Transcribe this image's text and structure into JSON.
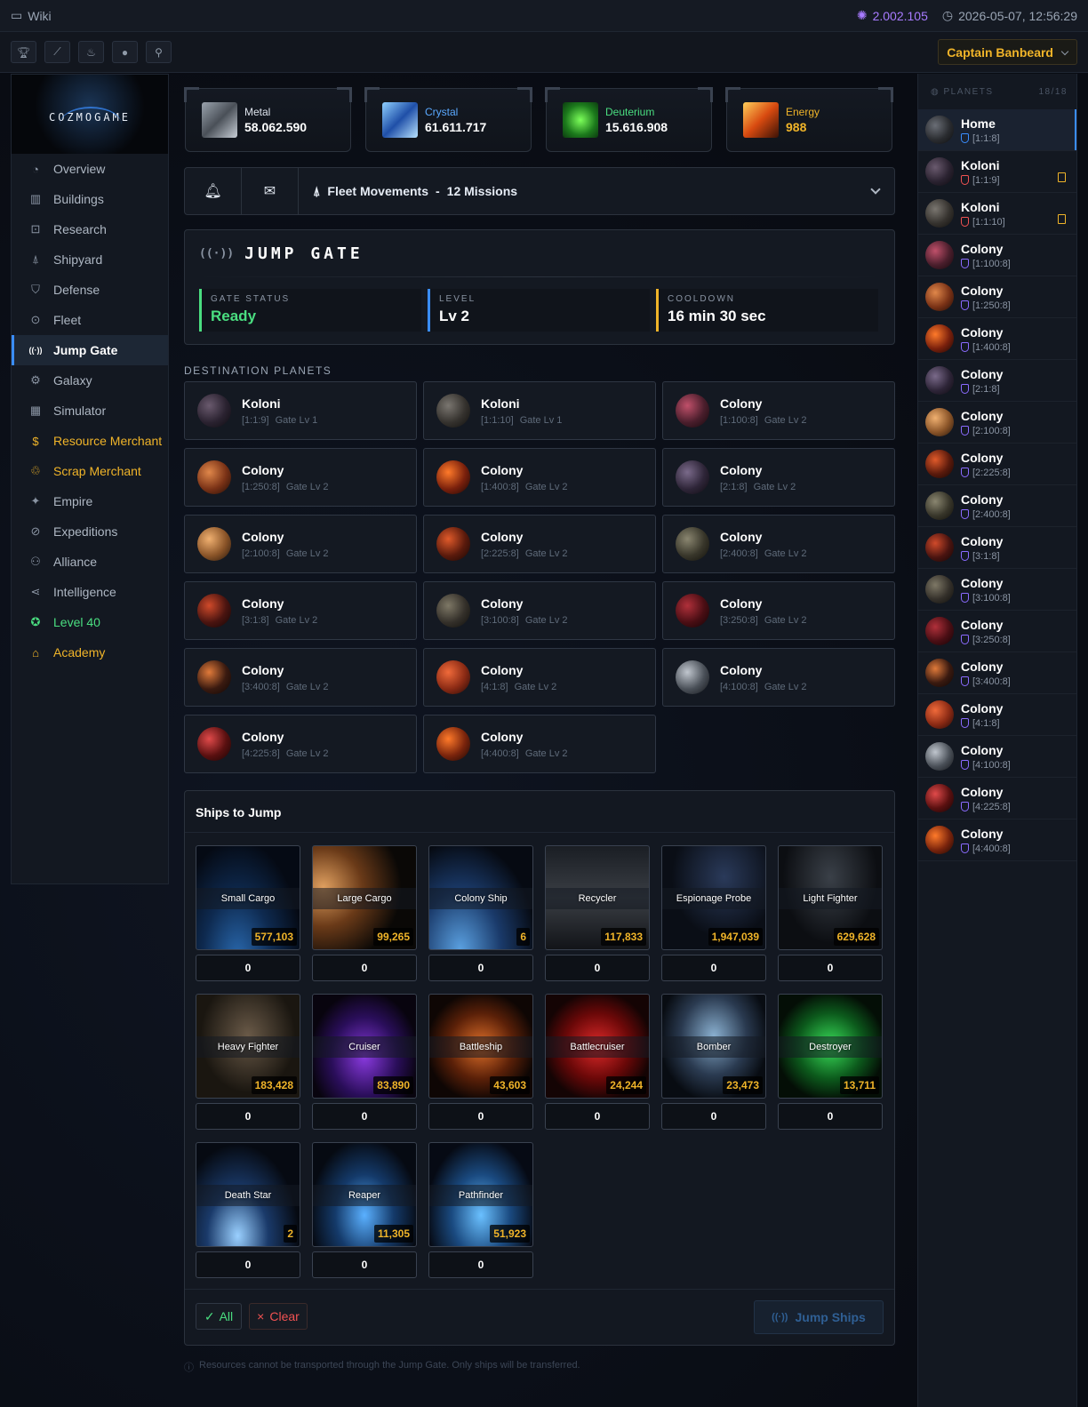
{
  "topbar": {
    "wiki": "Wiki",
    "dark_matter": "2.002.105",
    "datetime": "2026-05-07, 12:56:29"
  },
  "toolbar": {
    "captain": "Captain Banbeard"
  },
  "logo": "COZMOGAME",
  "nav": [
    {
      "label": "Overview",
      "icon": "gauge-icon",
      "glyph": "◔",
      "style": ""
    },
    {
      "label": "Buildings",
      "icon": "buildings-icon",
      "glyph": "▥",
      "style": ""
    },
    {
      "label": "Research",
      "icon": "chip-icon",
      "glyph": "⊡",
      "style": ""
    },
    {
      "label": "Shipyard",
      "icon": "rocket-icon",
      "glyph": "⍋",
      "style": ""
    },
    {
      "label": "Defense",
      "icon": "shield-icon",
      "glyph": "⛉",
      "style": ""
    },
    {
      "label": "Fleet",
      "icon": "target-icon",
      "glyph": "⊙",
      "style": ""
    },
    {
      "label": "Jump Gate",
      "icon": "signal-icon",
      "glyph": "((·))",
      "style": "active"
    },
    {
      "label": "Galaxy",
      "icon": "galaxy-icon",
      "glyph": "⚙",
      "style": ""
    },
    {
      "label": "Simulator",
      "icon": "calculator-icon",
      "glyph": "▦",
      "style": ""
    },
    {
      "label": "Resource Merchant",
      "icon": "coin-icon",
      "glyph": "$",
      "style": "gold"
    },
    {
      "label": "Scrap Merchant",
      "icon": "recycle-icon",
      "glyph": "♲",
      "style": "gold"
    },
    {
      "label": "Empire",
      "icon": "sparkle-icon",
      "glyph": "✦",
      "style": ""
    },
    {
      "label": "Expeditions",
      "icon": "compass-icon",
      "glyph": "⊘",
      "style": ""
    },
    {
      "label": "Alliance",
      "icon": "users-icon",
      "glyph": "⚇",
      "style": ""
    },
    {
      "label": "Intelligence",
      "icon": "share-icon",
      "glyph": "⋖",
      "style": ""
    },
    {
      "label": "Level 40",
      "icon": "award-icon",
      "glyph": "✪",
      "style": "green"
    },
    {
      "label": "Academy",
      "icon": "graduation-icon",
      "glyph": "⌂",
      "style": "gold"
    }
  ],
  "resources": [
    {
      "name": "Metal",
      "value": "58.062.590",
      "color": "#dfe5ee",
      "img": "linear-gradient(135deg,#9aa3ad,#4a5058 50%,#c7ced6)"
    },
    {
      "name": "Crystal",
      "value": "61.611.717",
      "color": "#5aa9ff",
      "img": "linear-gradient(135deg,#8fd0ff,#1f4fa8 50%,#b8e3ff)"
    },
    {
      "name": "Deuterium",
      "value": "15.616.908",
      "color": "#4ade80",
      "img": "radial-gradient(circle,#7cff5a,#1c7a1c 60%,#0c3a10)"
    },
    {
      "name": "Energy",
      "value": "988",
      "color": "#f0b429",
      "img": "linear-gradient(135deg,#ffcf5a,#d84a10 50%,#3a1206)"
    }
  ],
  "fleet": {
    "label": "Fleet Movements",
    "sep": "-",
    "missions": "12 Missions"
  },
  "gate": {
    "title": "JUMP GATE",
    "status_label": "GATE STATUS",
    "status": "Ready",
    "level_label": "LEVEL",
    "level": "Lv 2",
    "cooldown_label": "COOLDOWN",
    "cooldown": "16 min 30 sec",
    "status_color": "#4ade80",
    "level_color": "#3a8dff",
    "cooldown_color": "#f0b429"
  },
  "destinations_title": "DESTINATION PLANETS",
  "destinations": [
    {
      "name": "Koloni",
      "coords": "[1:1:9]",
      "gate": "Gate Lv 1",
      "planet": "radial-gradient(circle at 35% 35%,#6a5a6e,#2a2230 55%,#0d0b10)"
    },
    {
      "name": "Koloni",
      "coords": "[1:1:10]",
      "gate": "Gate Lv 1",
      "planet": "radial-gradient(circle at 35% 35%,#7a7670,#35322e 55%,#100f0d)"
    },
    {
      "name": "Colony",
      "coords": "[1:100:8]",
      "gate": "Gate Lv 2",
      "planet": "radial-gradient(circle at 35% 35%,#c0506a,#4a1e2c 55%,#14080c)"
    },
    {
      "name": "Colony",
      "coords": "[1:250:8]",
      "gate": "Gate Lv 2",
      "planet": "radial-gradient(circle at 35% 35%,#e0874a,#7a3216 55%,#1e0b05)"
    },
    {
      "name": "Colony",
      "coords": "[1:400:8]",
      "gate": "Gate Lv 2",
      "planet": "radial-gradient(circle at 35% 35%,#ff7a2a,#7a200c 55%,#160604)"
    },
    {
      "name": "Colony",
      "coords": "[2:1:8]",
      "gate": "Gate Lv 2",
      "planet": "radial-gradient(circle at 35% 35%,#7a6a8a,#2e2538 55%,#0d0a10)"
    },
    {
      "name": "Colony",
      "coords": "[2:100:8]",
      "gate": "Gate Lv 2",
      "planet": "radial-gradient(circle at 35% 35%,#f0b070,#8a5428 55%,#22140a)"
    },
    {
      "name": "Colony",
      "coords": "[2:225:8]",
      "gate": "Gate Lv 2",
      "planet": "radial-gradient(circle at 35% 35%,#e05a2a,#5a1a0c 55%,#140604)"
    },
    {
      "name": "Colony",
      "coords": "[2:400:8]",
      "gate": "Gate Lv 2",
      "planet": "radial-gradient(circle at 35% 35%,#8a8670,#38362a 55%,#100f0a)"
    },
    {
      "name": "Colony",
      "coords": "[3:1:8]",
      "gate": "Gate Lv 2",
      "planet": "radial-gradient(circle at 35% 35%,#d04a2a,#4a1410 55%,#120505)"
    },
    {
      "name": "Colony",
      "coords": "[3:100:8]",
      "gate": "Gate Lv 2",
      "planet": "radial-gradient(circle at 35% 35%,#7e7866,#34302a 55%,#0f0e0b)"
    },
    {
      "name": "Colony",
      "coords": "[3:250:8]",
      "gate": "Gate Lv 2",
      "planet": "radial-gradient(circle at 35% 35%,#b0303a,#4a0e14 55%,#120406)"
    },
    {
      "name": "Colony",
      "coords": "[3:400:8]",
      "gate": "Gate Lv 2",
      "planet": "radial-gradient(circle at 35% 35%,#e07a3a,#3a1a10 55%,#0e0604)"
    },
    {
      "name": "Colony",
      "coords": "[4:1:8]",
      "gate": "Gate Lv 2",
      "planet": "radial-gradient(circle at 35% 35%,#f06a3a,#8a2a14 55%,#200806)"
    },
    {
      "name": "Colony",
      "coords": "[4:100:8]",
      "gate": "Gate Lv 2",
      "planet": "radial-gradient(circle at 35% 35%,#c0c6ce,#4a5058 55%,#121418)"
    },
    {
      "name": "Colony",
      "coords": "[4:225:8]",
      "gate": "Gate Lv 2",
      "planet": "radial-gradient(circle at 35% 35%,#e04a4a,#5a1010 55%,#140404)"
    },
    {
      "name": "Colony",
      "coords": "[4:400:8]",
      "gate": "Gate Lv 2",
      "planet": "radial-gradient(circle at 35% 35%,#ff7a2a,#7a240c 55%,#160604)"
    }
  ],
  "ships_title": "Ships to Jump",
  "ships": [
    {
      "name": "Small Cargo",
      "count": "577,103",
      "input": "0",
      "bg": "radial-gradient(ellipse at 40% 110%,#2a6ab0,#0e2a50 40%,#050a14 75%)"
    },
    {
      "name": "Large Cargo",
      "count": "99,265",
      "input": "0",
      "bg": "radial-gradient(circle at 10% 40%,#e0a060,#6a3a18 35%,#0a0806 70%)"
    },
    {
      "name": "Colony Ship",
      "count": "6",
      "input": "0",
      "bg": "radial-gradient(ellipse at 30% 100%,#5aa0e0,#1a3a6a 40%,#060a12 75%)"
    },
    {
      "name": "Recycler",
      "count": "117,833",
      "input": "0",
      "bg": "linear-gradient(180deg,#1a1e24,#3a3e44 50%,#121418)"
    },
    {
      "name": "Espionage Probe",
      "count": "1,947,039",
      "input": "0",
      "bg": "radial-gradient(ellipse at 60% 30%,#2a3a5a,#0a0e16 60%)"
    },
    {
      "name": "Light Fighter",
      "count": "629,628",
      "input": "0",
      "bg": "radial-gradient(ellipse at 50% 30%,#3a4048,#0c0e12 65%)"
    },
    {
      "name": "Heavy Fighter",
      "count": "183,428",
      "input": "0",
      "bg": "radial-gradient(ellipse at 50% 40%,#6a5a48,#1a1610 65%)"
    },
    {
      "name": "Cruiser",
      "count": "83,890",
      "input": "0",
      "bg": "radial-gradient(ellipse at 50% 60%,#8a3ae0,#2a0e5a 45%,#08040e 75%)"
    },
    {
      "name": "Battleship",
      "count": "43,603",
      "input": "0",
      "bg": "radial-gradient(ellipse at 50% 50%,#e0702a,#5a2008 45%,#0e0604 75%)"
    },
    {
      "name": "Battlecruiser",
      "count": "24,244",
      "input": "0",
      "bg": "radial-gradient(ellipse at 50% 50%,#e02a2a,#6a0808 45%,#140404 75%)"
    },
    {
      "name": "Bomber",
      "count": "23,473",
      "input": "0",
      "bg": "radial-gradient(ellipse at 50% 40%,#8ab0d0,#2a3a50 45%,#080c12 75%)"
    },
    {
      "name": "Destroyer",
      "count": "13,711",
      "input": "0",
      "bg": "radial-gradient(ellipse at 50% 50%,#3ae05a,#0c5a1c 45%,#040e06 75%)"
    },
    {
      "name": "Death Star",
      "count": "2",
      "input": "0",
      "bg": "radial-gradient(ellipse at 40% 90%,#9ad0ff,#1a3a6a 35%,#060a12 70%)"
    },
    {
      "name": "Reaper",
      "count": "11,305",
      "input": "0",
      "bg": "radial-gradient(ellipse at 50% 70%,#5ab0ff,#143a6a 40%,#060a12 75%)"
    },
    {
      "name": "Pathfinder",
      "count": "51,923",
      "input": "0",
      "bg": "radial-gradient(ellipse at 50% 70%,#6ac0ff,#1a4a80 40%,#060a14 75%)"
    }
  ],
  "buttons": {
    "all": "All",
    "clear": "Clear",
    "jump": "Jump Ships"
  },
  "note": "Resources cannot be transported through the Jump Gate. Only ships will be transferred.",
  "planets_panel": {
    "title": "PLANETS",
    "count": "18/18"
  },
  "planets": [
    {
      "name": "Home",
      "coords": "[1:1:8]",
      "shield": "blue",
      "building": false,
      "active": true,
      "planet": "radial-gradient(circle at 35% 35%,#6a6e76,#2a2c30 55%,#0c0d0f)"
    },
    {
      "name": "Koloni",
      "coords": "[1:1:9]",
      "shield": "red",
      "building": true,
      "active": false,
      "planet": "radial-gradient(circle at 35% 35%,#6a5a6e,#2a2230 55%,#0d0b10)"
    },
    {
      "name": "Koloni",
      "coords": "[1:1:10]",
      "shield": "red",
      "building": true,
      "active": false,
      "planet": "radial-gradient(circle at 35% 35%,#7a7670,#35322e 55%,#100f0d)"
    },
    {
      "name": "Colony",
      "coords": "[1:100:8]",
      "shield": "",
      "building": false,
      "active": false,
      "planet": "radial-gradient(circle at 35% 35%,#c0506a,#4a1e2c 55%,#14080c)"
    },
    {
      "name": "Colony",
      "coords": "[1:250:8]",
      "shield": "",
      "building": false,
      "active": false,
      "planet": "radial-gradient(circle at 35% 35%,#e0874a,#7a3216 55%,#1e0b05)"
    },
    {
      "name": "Colony",
      "coords": "[1:400:8]",
      "shield": "",
      "building": false,
      "active": false,
      "planet": "radial-gradient(circle at 35% 35%,#ff7a2a,#7a200c 55%,#160604)"
    },
    {
      "name": "Colony",
      "coords": "[2:1:8]",
      "shield": "",
      "building": false,
      "active": false,
      "planet": "radial-gradient(circle at 35% 35%,#7a6a8a,#2e2538 55%,#0d0a10)"
    },
    {
      "name": "Colony",
      "coords": "[2:100:8]",
      "shield": "",
      "building": false,
      "active": false,
      "planet": "radial-gradient(circle at 35% 35%,#f0b070,#8a5428 55%,#22140a)"
    },
    {
      "name": "Colony",
      "coords": "[2:225:8]",
      "shield": "",
      "building": false,
      "active": false,
      "planet": "radial-gradient(circle at 35% 35%,#e05a2a,#5a1a0c 55%,#140604)"
    },
    {
      "name": "Colony",
      "coords": "[2:400:8]",
      "shield": "",
      "building": false,
      "active": false,
      "planet": "radial-gradient(circle at 35% 35%,#8a8670,#38362a 55%,#100f0a)"
    },
    {
      "name": "Colony",
      "coords": "[3:1:8]",
      "shield": "",
      "building": false,
      "active": false,
      "planet": "radial-gradient(circle at 35% 35%,#d04a2a,#4a1410 55%,#120505)"
    },
    {
      "name": "Colony",
      "coords": "[3:100:8]",
      "shield": "",
      "building": false,
      "active": false,
      "planet": "radial-gradient(circle at 35% 35%,#7e7866,#34302a 55%,#0f0e0b)"
    },
    {
      "name": "Colony",
      "coords": "[3:250:8]",
      "shield": "",
      "building": false,
      "active": false,
      "planet": "radial-gradient(circle at 35% 35%,#b0303a,#4a0e14 55%,#120406)"
    },
    {
      "name": "Colony",
      "coords": "[3:400:8]",
      "shield": "",
      "building": false,
      "active": false,
      "planet": "radial-gradient(circle at 35% 35%,#e07a3a,#3a1a10 55%,#0e0604)"
    },
    {
      "name": "Colony",
      "coords": "[4:1:8]",
      "shield": "",
      "building": false,
      "active": false,
      "planet": "radial-gradient(circle at 35% 35%,#f06a3a,#8a2a14 55%,#200806)"
    },
    {
      "name": "Colony",
      "coords": "[4:100:8]",
      "shield": "",
      "building": false,
      "active": false,
      "planet": "radial-gradient(circle at 35% 35%,#c0c6ce,#4a5058 55%,#121418)"
    },
    {
      "name": "Colony",
      "coords": "[4:225:8]",
      "shield": "",
      "building": false,
      "active": false,
      "planet": "radial-gradient(circle at 35% 35%,#e04a4a,#5a1010 55%,#140404)"
    },
    {
      "name": "Colony",
      "coords": "[4:400:8]",
      "shield": "",
      "building": false,
      "active": false,
      "planet": "radial-gradient(circle at 35% 35%,#ff7a2a,#7a240c 55%,#160604)"
    }
  ]
}
